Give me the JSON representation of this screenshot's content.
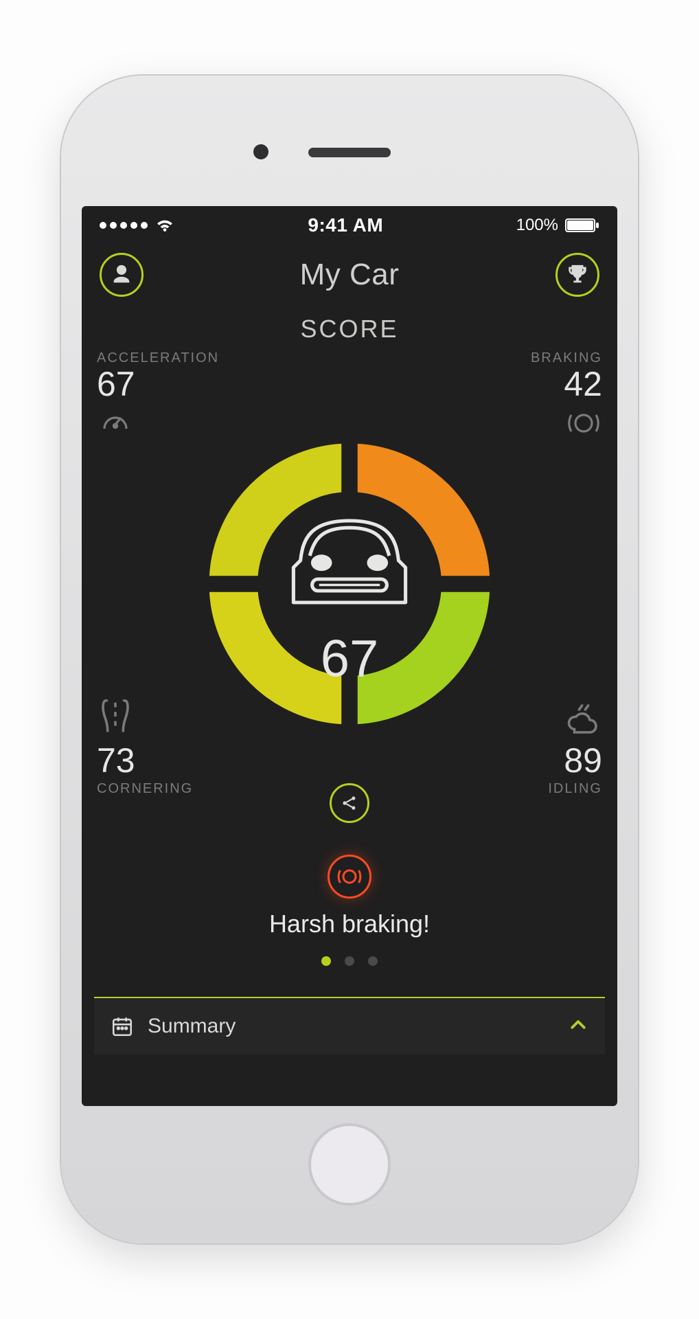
{
  "status": {
    "time": "9:41 AM",
    "battery": "100%"
  },
  "nav": {
    "title": "My Car"
  },
  "score": {
    "label": "SCORE",
    "overall": "67",
    "metrics": {
      "acceleration": {
        "label": "ACCELERATION",
        "value": "67"
      },
      "braking": {
        "label": "BRAKING",
        "value": "42"
      },
      "cornering": {
        "label": "CORNERING",
        "value": "73"
      },
      "idling": {
        "label": "IDLING",
        "value": "89"
      }
    }
  },
  "alert": {
    "text": "Harsh braking!"
  },
  "summary": {
    "label": "Summary"
  },
  "colors": {
    "accent": "#b8cf1f",
    "warn": "#ff4a24",
    "ring_tl": "#d0cf1a",
    "ring_tr": "#f08a1a",
    "ring_br": "#a4d21e",
    "ring_bl": "#d6d21a"
  },
  "pager": {
    "count": 3,
    "active": 0
  }
}
